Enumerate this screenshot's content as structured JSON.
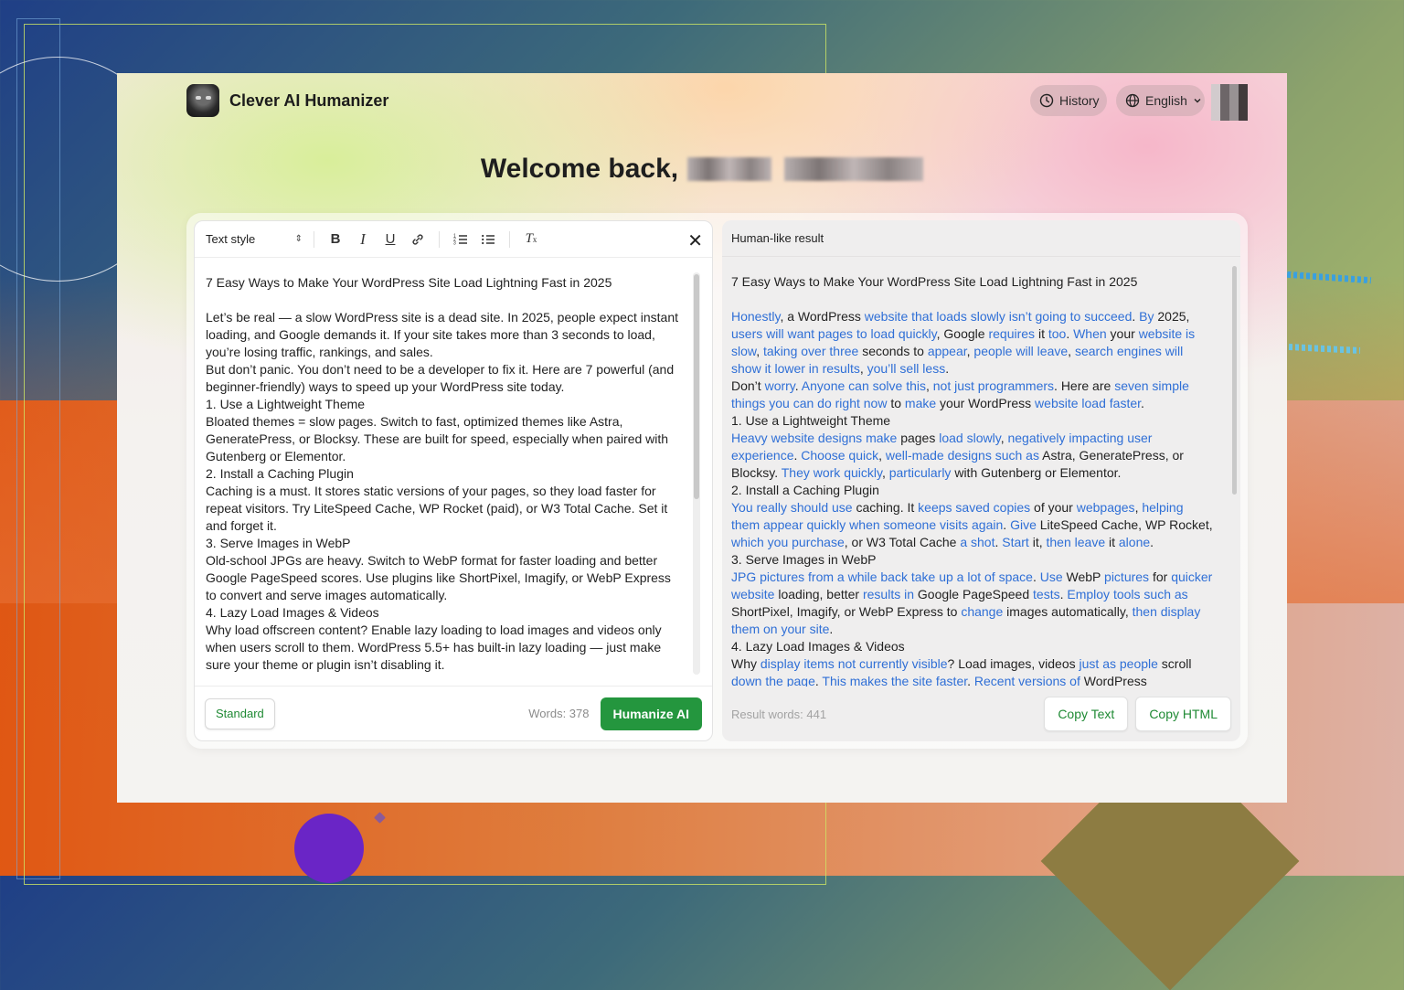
{
  "app": {
    "brand": "Clever AI Humanizer"
  },
  "header": {
    "history_label": "History",
    "language_label": "English"
  },
  "welcome": {
    "text": "Welcome back,"
  },
  "editor": {
    "text_style_label": "Text style",
    "toolbar_icons": [
      "bold-icon",
      "italic-icon",
      "underline-icon",
      "link-icon",
      "ordered-list-icon",
      "bullet-list-icon",
      "clear-format-icon"
    ],
    "paragraphs": [
      "7 Easy Ways to Make Your WordPress Site Load Lightning Fast in 2025",
      "",
      "Let’s be real — a slow WordPress site is a dead site. In 2025, people expect instant loading, and Google demands it. If your site takes more than 3 seconds to load, you’re losing traffic, rankings, and sales.",
      "But don’t panic. You don’t need to be a developer to fix it. Here are 7 powerful (and beginner-friendly) ways to speed up your WordPress site today.",
      "1. Use a Lightweight Theme",
      "Bloated themes = slow pages. Switch to fast, optimized themes like Astra, GeneratePress, or Blocksy. These are built for speed, especially when paired with Gutenberg or Elementor.",
      "2. Install a Caching Plugin",
      "Caching is a must. It stores static versions of your pages, so they load faster for repeat visitors. Try LiteSpeed Cache, WP Rocket (paid), or W3 Total Cache. Set it and forget it.",
      "3. Serve Images in WebP",
      "Old-school JPGs are heavy. Switch to WebP format for faster loading and better Google PageSpeed scores. Use plugins like ShortPixel, Imagify, or WebP Express to convert and serve images automatically.",
      "4. Lazy Load Images & Videos",
      "Why load offscreen content? Enable lazy loading to load images and videos only when users scroll to them. WordPress 5.5+ has built-in lazy loading — just make sure your theme or plugin isn’t disabling it."
    ],
    "mode_label": "Standard",
    "word_count": "Words: 378",
    "humanize_label": "Humanize AI"
  },
  "result": {
    "header": "Human-like result",
    "paragraphs": [
      [
        {
          "t": "7 Easy Ways to Make Your WordPress Site Load Lightning Fast in 2025",
          "h": false
        }
      ],
      [],
      [
        {
          "t": "Honestly",
          "h": true
        },
        {
          "t": ", a WordPress ",
          "h": false
        },
        {
          "t": "website that loads slowly isn’t going to succeed",
          "h": true
        },
        {
          "t": ". ",
          "h": false
        },
        {
          "t": "By",
          "h": true
        },
        {
          "t": " 2025, ",
          "h": false
        },
        {
          "t": "users will want pages to load quickly",
          "h": true
        },
        {
          "t": ", Google ",
          "h": false
        },
        {
          "t": "requires",
          "h": true
        },
        {
          "t": " it ",
          "h": false
        },
        {
          "t": "too",
          "h": true
        },
        {
          "t": ". ",
          "h": false
        },
        {
          "t": "When",
          "h": true
        },
        {
          "t": " your ",
          "h": false
        },
        {
          "t": "website is slow",
          "h": true
        },
        {
          "t": ", ",
          "h": false
        },
        {
          "t": "taking over three",
          "h": true
        },
        {
          "t": " seconds to ",
          "h": false
        },
        {
          "t": "appear",
          "h": true
        },
        {
          "t": ", ",
          "h": false
        },
        {
          "t": "people will leave",
          "h": true
        },
        {
          "t": ", ",
          "h": false
        },
        {
          "t": "search engines will show it lower in results",
          "h": true
        },
        {
          "t": ", ",
          "h": false
        },
        {
          "t": "you’ll sell less",
          "h": true
        },
        {
          "t": ".",
          "h": false
        }
      ],
      [
        {
          "t": "Don’t ",
          "h": false
        },
        {
          "t": "worry",
          "h": true
        },
        {
          "t": ". ",
          "h": false
        },
        {
          "t": "Anyone can solve this",
          "h": true
        },
        {
          "t": ", ",
          "h": false
        },
        {
          "t": "not just programmers",
          "h": true
        },
        {
          "t": ". Here are ",
          "h": false
        },
        {
          "t": "seven simple things you can do right now",
          "h": true
        },
        {
          "t": " to ",
          "h": false
        },
        {
          "t": "make",
          "h": true
        },
        {
          "t": " your WordPress ",
          "h": false
        },
        {
          "t": "website load faster",
          "h": true
        },
        {
          "t": ".",
          "h": false
        }
      ],
      [
        {
          "t": "1. Use a Lightweight Theme",
          "h": false
        }
      ],
      [
        {
          "t": "Heavy website designs make",
          "h": true
        },
        {
          "t": " pages ",
          "h": false
        },
        {
          "t": "load slowly",
          "h": true
        },
        {
          "t": ", ",
          "h": false
        },
        {
          "t": "negatively impacting user experience",
          "h": true
        },
        {
          "t": ". ",
          "h": false
        },
        {
          "t": "Choose quick",
          "h": true
        },
        {
          "t": ", ",
          "h": false
        },
        {
          "t": "well-made designs such as",
          "h": true
        },
        {
          "t": " Astra, GeneratePress, or Blocksy. ",
          "h": false
        },
        {
          "t": "They work quickly",
          "h": true
        },
        {
          "t": ", ",
          "h": false
        },
        {
          "t": "particularly",
          "h": true
        },
        {
          "t": " with Gutenberg or Elementor.",
          "h": false
        }
      ],
      [
        {
          "t": "2. Install a Caching Plugin",
          "h": false
        }
      ],
      [
        {
          "t": "You really should use",
          "h": true
        },
        {
          "t": " caching. It ",
          "h": false
        },
        {
          "t": "keeps saved copies",
          "h": true
        },
        {
          "t": " of your ",
          "h": false
        },
        {
          "t": "webpages",
          "h": true
        },
        {
          "t": ", ",
          "h": false
        },
        {
          "t": "helping them appear quickly when someone visits again",
          "h": true
        },
        {
          "t": ". ",
          "h": false
        },
        {
          "t": "Give",
          "h": true
        },
        {
          "t": " LiteSpeed Cache, WP Rocket, ",
          "h": false
        },
        {
          "t": "which you purchase",
          "h": true
        },
        {
          "t": ", or W3 Total Cache ",
          "h": false
        },
        {
          "t": "a shot",
          "h": true
        },
        {
          "t": ". ",
          "h": false
        },
        {
          "t": "Start",
          "h": true
        },
        {
          "t": " it, ",
          "h": false
        },
        {
          "t": "then leave",
          "h": true
        },
        {
          "t": " it ",
          "h": false
        },
        {
          "t": "alone",
          "h": true
        },
        {
          "t": ".",
          "h": false
        }
      ],
      [
        {
          "t": "3. Serve Images in WebP",
          "h": false
        }
      ],
      [
        {
          "t": "JPG pictures from a while back take up a lot of space",
          "h": true
        },
        {
          "t": ". ",
          "h": false
        },
        {
          "t": "Use",
          "h": true
        },
        {
          "t": " WebP ",
          "h": false
        },
        {
          "t": "pictures",
          "h": true
        },
        {
          "t": " for ",
          "h": false
        },
        {
          "t": "quicker website",
          "h": true
        },
        {
          "t": " loading, better ",
          "h": false
        },
        {
          "t": "results in",
          "h": true
        },
        {
          "t": " Google PageSpeed ",
          "h": false
        },
        {
          "t": "tests",
          "h": true
        },
        {
          "t": ". ",
          "h": false
        },
        {
          "t": "Employ tools such as",
          "h": true
        },
        {
          "t": " ShortPixel, Imagify, or WebP Express to ",
          "h": false
        },
        {
          "t": "change",
          "h": true
        },
        {
          "t": " images automatically, ",
          "h": false
        },
        {
          "t": "then display them on your site",
          "h": true
        },
        {
          "t": ".",
          "h": false
        }
      ],
      [
        {
          "t": "4. Lazy Load Images & Videos",
          "h": false
        }
      ],
      [
        {
          "t": "Why ",
          "h": false
        },
        {
          "t": "display items not currently visible",
          "h": true
        },
        {
          "t": "? Load images, videos ",
          "h": false
        },
        {
          "t": "just as people",
          "h": true
        },
        {
          "t": " scroll ",
          "h": false
        },
        {
          "t": "down the page",
          "h": true
        },
        {
          "t": ". ",
          "h": false
        },
        {
          "t": "This makes the site faster",
          "h": true
        },
        {
          "t": ". ",
          "h": false
        },
        {
          "t": "Recent versions of",
          "h": true
        },
        {
          "t": " WordPress",
          "h": false
        }
      ]
    ],
    "word_count": "Result words: 441",
    "copy_text_label": "Copy Text",
    "copy_html_label": "Copy HTML"
  },
  "colors": {
    "accent_green": "#24963e",
    "highlight_blue": "#2f6fd6"
  }
}
